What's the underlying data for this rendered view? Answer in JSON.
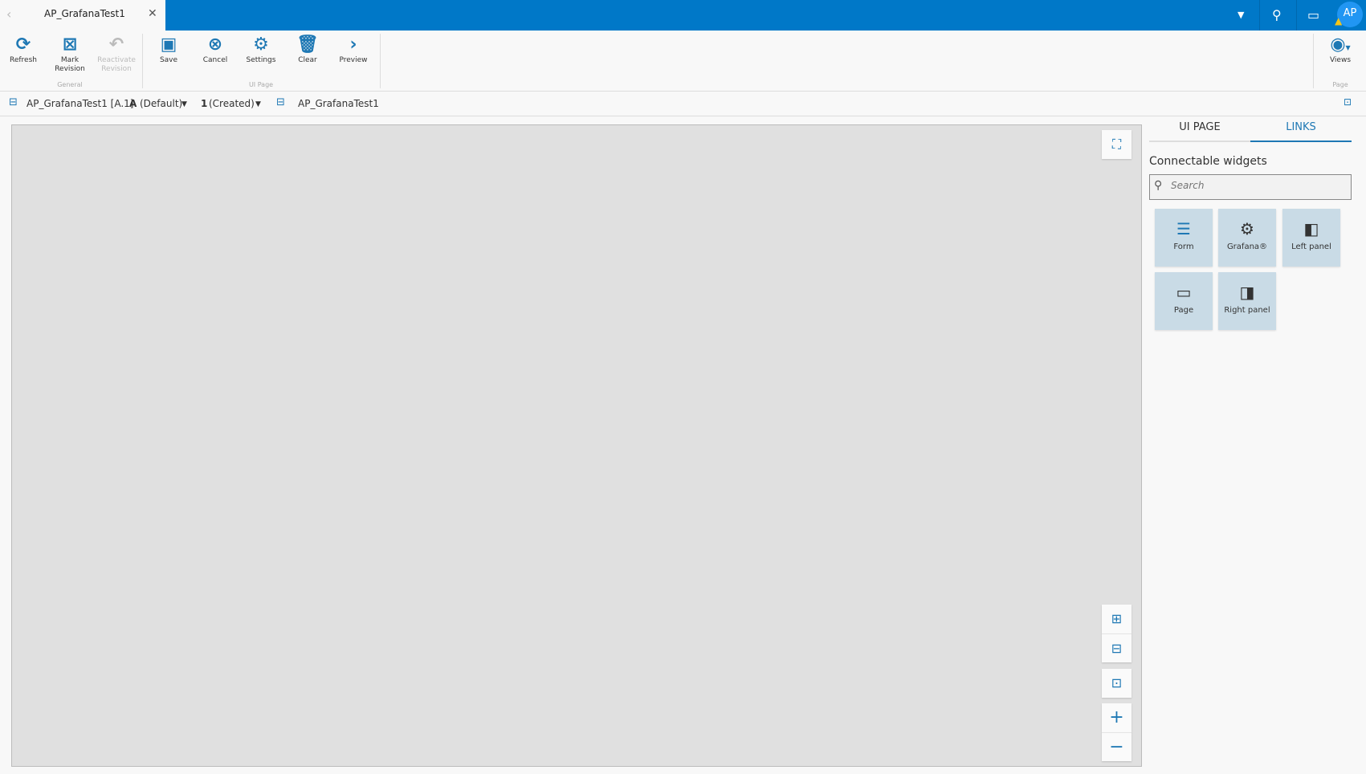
{
  "tab": {
    "title": "AP_GrafanaTest1"
  },
  "header": {
    "avatar": "AP"
  },
  "toolbar": {
    "refresh": "Refresh",
    "mark_revision": "Mark Revision",
    "reactivate_revision": "Reactivate Revision",
    "group_general": "General",
    "save": "Save",
    "cancel": "Cancel",
    "settings": "Settings",
    "clear": "Clear",
    "preview": "Preview",
    "group_ui_page": "UI Page",
    "views": "Views",
    "group_page": "Page"
  },
  "breadcrumb": {
    "page": "AP_GrafanaTest1 [A.1]",
    "variant_key": "A",
    "variant": "(Default)",
    "revision_key": "1",
    "revision": "(Created)",
    "layout": "AP_GrafanaTest1"
  },
  "panel": {
    "tabs": [
      "UI PAGE",
      "LINKS"
    ],
    "heading": "Connectable widgets",
    "search_placeholder": "Search",
    "widgets": [
      "Form",
      "Grafana®",
      "Left panel",
      "Page",
      "Right panel"
    ]
  }
}
